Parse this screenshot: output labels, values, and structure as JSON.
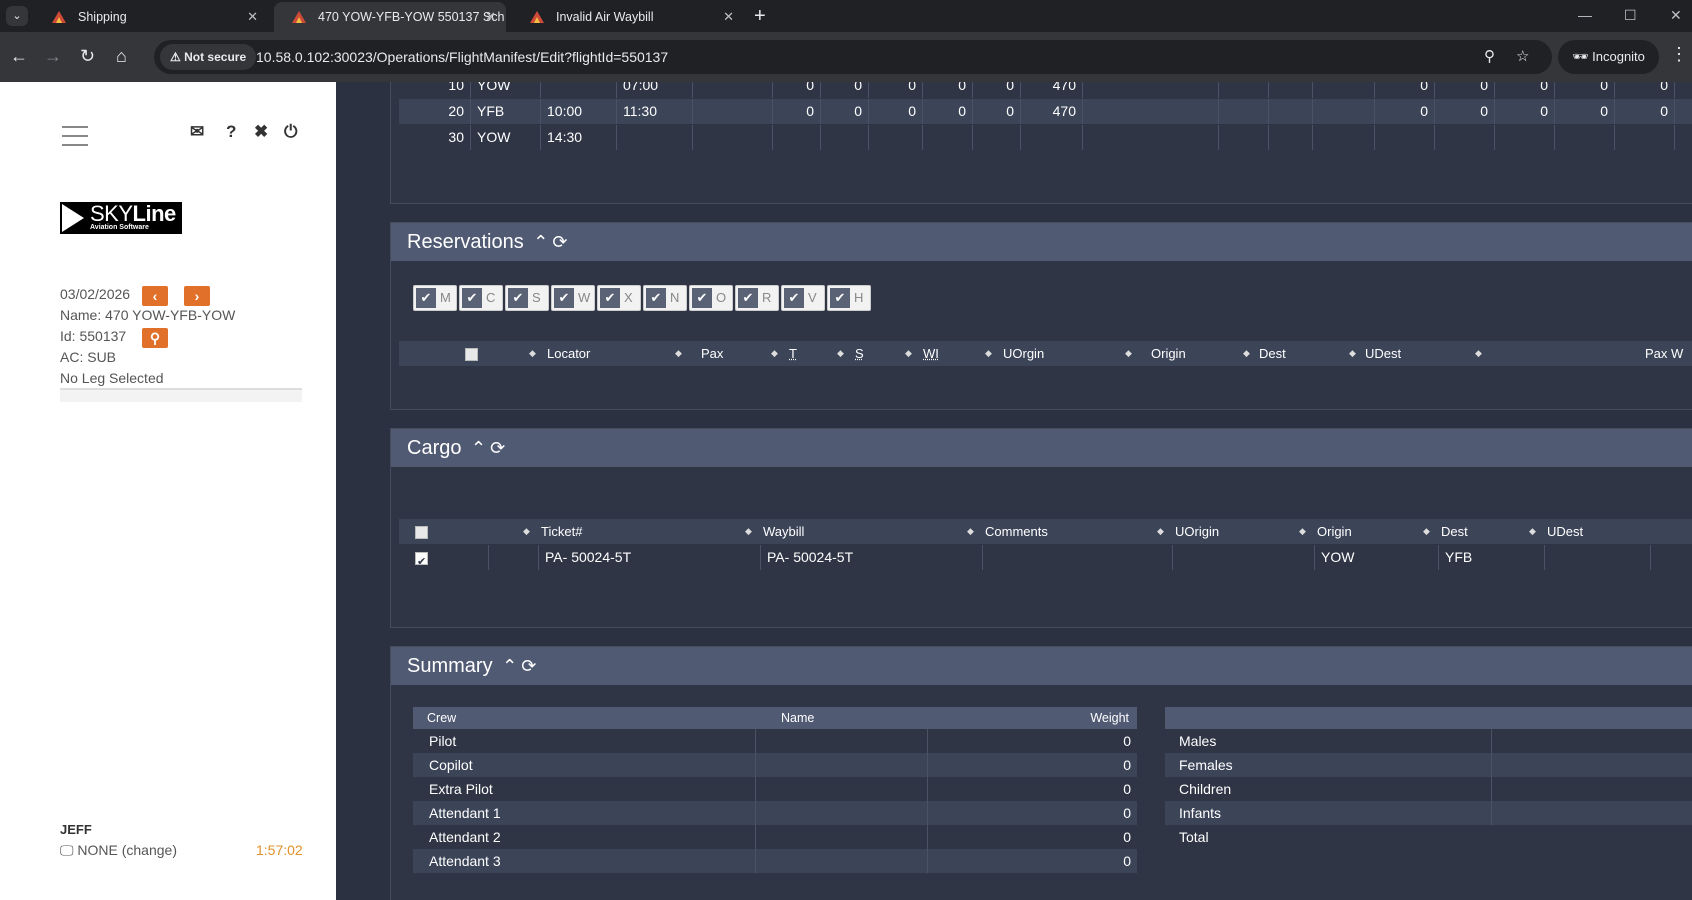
{
  "browser": {
    "tabs": [
      {
        "title": "Shipping",
        "active": false
      },
      {
        "title": "470 YOW-YFB-YOW 550137 Sch",
        "active": true
      },
      {
        "title": "Invalid Air Waybill",
        "active": false
      }
    ],
    "security_label": "Not secure",
    "url": "10.58.0.102:30023/Operations/FlightManifest/Edit?flightId=550137",
    "incognito_label": "Incognito"
  },
  "sidebar": {
    "logo": {
      "brand_light": "SKY",
      "brand_bold": "Line",
      "tagline": "Aviation Software"
    },
    "date": "03/02/2026",
    "name": "Name: 470 YOW-YFB-YOW",
    "id": "Id: 550137",
    "ac": "AC: SUB",
    "leg_status": "No Leg Selected",
    "user": "JEFF",
    "workstation": "NONE (change)",
    "timer": "1:57:02"
  },
  "legs": {
    "rows": [
      {
        "seq": "10",
        "station": "YOW",
        "arr": "",
        "dep": "07:00",
        "n": [
          "0",
          "0",
          "0",
          "0",
          "0"
        ],
        "flt": "470",
        "m": [
          "0",
          "0",
          "0",
          "0",
          "0"
        ]
      },
      {
        "seq": "20",
        "station": "YFB",
        "arr": "10:00",
        "dep": "11:30",
        "n": [
          "0",
          "0",
          "0",
          "0",
          "0"
        ],
        "flt": "470",
        "m": [
          "0",
          "0",
          "0",
          "0",
          "0"
        ]
      },
      {
        "seq": "30",
        "station": "YOW",
        "arr": "14:30",
        "dep": "",
        "n": [
          "",
          "",
          "",
          "",
          ""
        ],
        "flt": "",
        "m": [
          "",
          "",
          "",
          "",
          ""
        ]
      }
    ]
  },
  "reservations": {
    "title": "Reservations",
    "filters": [
      "M",
      "C",
      "S",
      "W",
      "X",
      "N",
      "O",
      "R",
      "V",
      "H"
    ],
    "columns": [
      "Locator",
      "Pax",
      "T",
      "S",
      "WI",
      "UOrgin",
      "Origin",
      "Dest",
      "UDest",
      "Pax W"
    ]
  },
  "cargo": {
    "title": "Cargo",
    "columns": [
      "Ticket#",
      "Waybill",
      "Comments",
      "UOrigin",
      "Origin",
      "Dest",
      "UDest"
    ],
    "rows": [
      {
        "checked": true,
        "ticket": "PA- 50024-5T",
        "waybill": "PA- 50024-5T",
        "comments": "",
        "uorigin": "",
        "origin": "YOW",
        "dest": "YFB",
        "udest": ""
      }
    ]
  },
  "summary": {
    "title": "Summary",
    "crew_headers": [
      "Crew",
      "Name",
      "Weight"
    ],
    "crew": [
      {
        "role": "Pilot",
        "name": "",
        "weight": "0"
      },
      {
        "role": "Copilot",
        "name": "",
        "weight": "0"
      },
      {
        "role": "Extra Pilot",
        "name": "",
        "weight": "0"
      },
      {
        "role": "Attendant 1",
        "name": "",
        "weight": "0"
      },
      {
        "role": "Attendant 2",
        "name": "",
        "weight": "0"
      },
      {
        "role": "Attendant 3",
        "name": "",
        "weight": "0"
      }
    ],
    "pax": [
      "Males",
      "Females",
      "Children",
      "Infants",
      "Total"
    ]
  }
}
